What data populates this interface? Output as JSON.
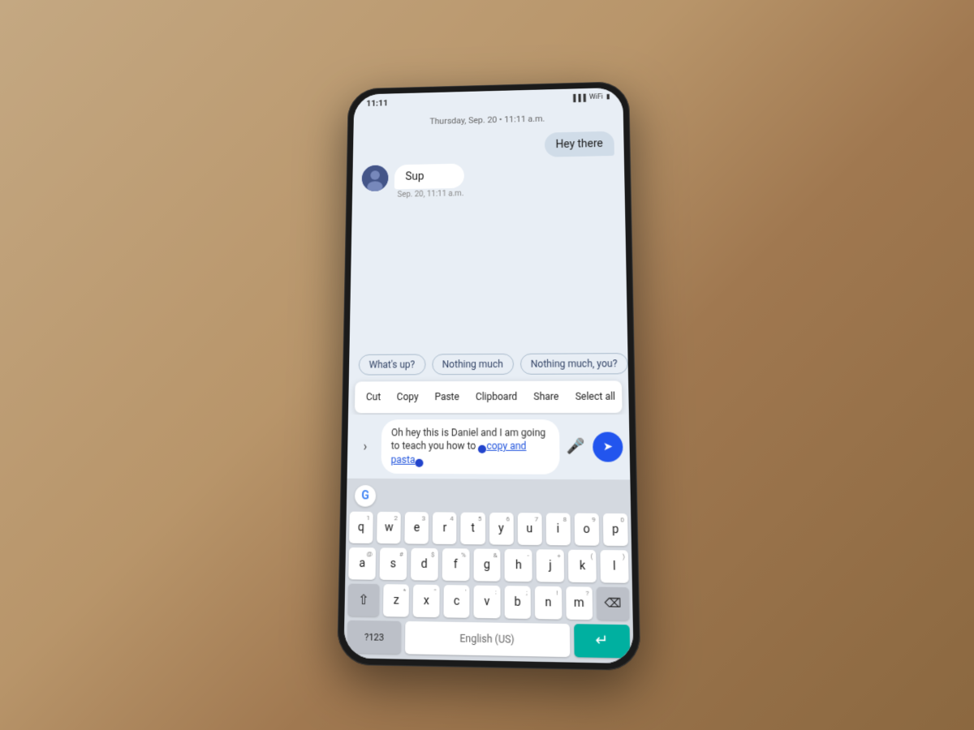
{
  "background": {
    "color": "#b8956a"
  },
  "phone": {
    "status_bar": {
      "time": "11:11",
      "icons": [
        "signal",
        "wifi",
        "battery"
      ]
    },
    "chat": {
      "timestamp": "Thursday, Sep. 20 • 11:11 a.m.",
      "messages": [
        {
          "id": "msg1",
          "type": "sent",
          "text": "Hey there"
        },
        {
          "id": "msg2",
          "type": "received",
          "text": "Sup",
          "time": "Sep. 20, 11:11 a.m."
        }
      ],
      "smart_replies": [
        "What's up?",
        "Nothing much",
        "Nothing much, you?"
      ],
      "input_text_before": "Oh hey this is Daniel and I am going to teach you how to ",
      "input_text_selected": "copy and pasta",
      "toolbar_items": [
        "Cut",
        "Copy",
        "Paste",
        "Clipboard",
        "Share",
        "Select all"
      ],
      "toolbar_more": "⋮"
    },
    "keyboard": {
      "rows": [
        [
          "q",
          "w",
          "e",
          "r",
          "t",
          "y",
          "u",
          "i",
          "o",
          "p"
        ],
        [
          "a",
          "s",
          "d",
          "f",
          "g",
          "h",
          "j",
          "k",
          "l"
        ],
        [
          "z",
          "x",
          "c",
          "v",
          "b",
          "n",
          "m"
        ]
      ],
      "num_hints": {
        "q": "1",
        "w": "2",
        "e": "3",
        "r": "4",
        "t": "5",
        "y": "6",
        "u": "7",
        "i": "8",
        "o": "9",
        "p": "0",
        "a": "@",
        "s": "#",
        "d": "$",
        "f": "%",
        "g": "&",
        "h": "-",
        "j": "+",
        "k": "(",
        "l": ")",
        "z": "*",
        "x": "\"",
        "c": "'",
        "v": ":",
        "b": ";",
        "n": "!",
        "m": "?"
      }
    }
  }
}
